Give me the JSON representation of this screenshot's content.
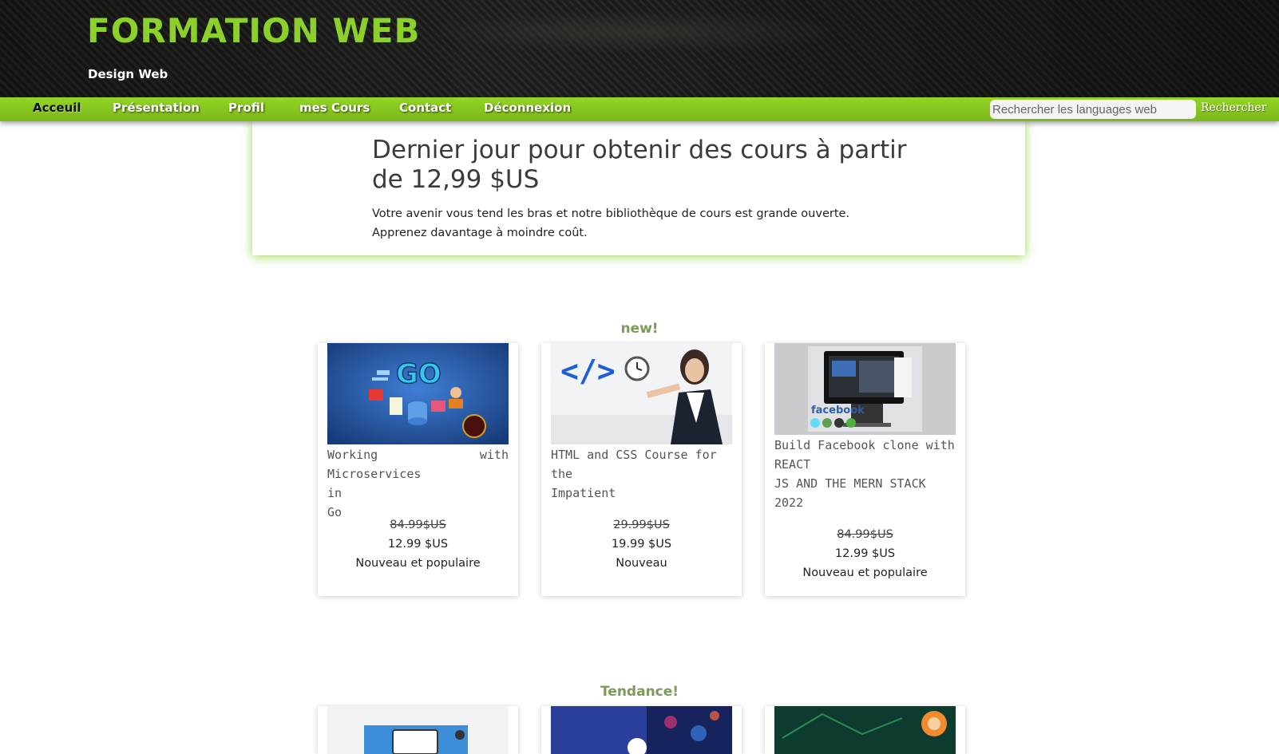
{
  "header": {
    "title": "FORMATION WEB",
    "subtitle": "Design Web"
  },
  "nav": {
    "items": [
      {
        "label": "Acceuil",
        "active": true
      },
      {
        "label": "Présentation"
      },
      {
        "label": "Profil"
      },
      {
        "label": "mes Cours"
      },
      {
        "label": "Contact"
      },
      {
        "label": "Déconnexion"
      }
    ],
    "search_placeholder": "Rechercher les languages web",
    "search_button": "Rechercher"
  },
  "promo": {
    "title": "Dernier jour pour obtenir des cours à partir de 12,99 $US",
    "text": "Votre avenir vous tend les bras et notre bibliothèque de cours est grande ouverte. Apprenez davantage à moindre coût."
  },
  "sections": [
    {
      "heading": "new!",
      "courses": [
        {
          "title_lines": [
            "Working with Microservices",
            "in",
            "Go"
          ],
          "old_price": "84.99$US",
          "price": "12.99 $US",
          "badge": "Nouveau et populaire"
        },
        {
          "title_lines": [
            "HTML and CSS Course for",
            "the",
            "Impatient"
          ],
          "old_price": "29.99$US",
          "price": "19.99 $US",
          "badge": "Nouveau"
        },
        {
          "title_lines": [
            "Build Facebook clone with",
            "REACT",
            "JS AND THE MERN STACK",
            "2022"
          ],
          "old_price": "84.99$US",
          "price": "12.99 $US",
          "badge": "Nouveau et populaire"
        }
      ]
    },
    {
      "heading": "Tendance!"
    }
  ],
  "colors": {
    "brand_green": "#8bd12a",
    "nav_green": "#8ccc22",
    "heading_green": "#7d9a5a"
  }
}
